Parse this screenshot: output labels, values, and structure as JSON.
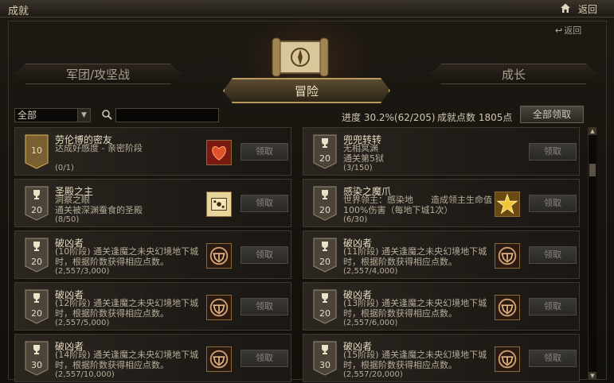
{
  "window": {
    "title": "成就",
    "back_label": "返回"
  },
  "sub_back_label": "返回",
  "tabs": {
    "left": "军团/攻坚战",
    "active": "冒险",
    "right": "成长"
  },
  "filter": {
    "selected": "全部",
    "search_placeholder": ""
  },
  "summary": {
    "progress": "进度 30.2%(62/205)",
    "points": "成就点数 1805点",
    "claim_all": "全部领取"
  },
  "colors": {
    "accent": "#b89a5e",
    "reward_red": "#c0301a",
    "reward_gold": "#e2b53a",
    "reward_dark": "#3a2a1a"
  },
  "achievements": [
    {
      "name": "劳伦博的密友",
      "desc": "达成好感度 - 亲密阶段",
      "progress": "(0/1)",
      "points": "10",
      "icon": "heart-reward-icon",
      "claim": "领取"
    },
    {
      "name": "兜兜转转",
      "desc": "无相冥渊\n通关第5狱",
      "progress": "(3/150)",
      "points": "20",
      "icon": "",
      "claim": "领取"
    },
    {
      "name": "圣殿之主",
      "desc": "洞察之眼\n通关被深渊蚕食的圣殿",
      "progress": "(8/50)",
      "points": "20",
      "icon": "map-reward-icon",
      "claim": "领取"
    },
    {
      "name": "感染之魔爪",
      "desc": "世界领主：感染地　　造成领主生命值100%伤害（每地下城1次）",
      "progress": "(6/30)",
      "points": "20",
      "icon": "star-reward-icon",
      "claim": "领取"
    },
    {
      "name": "破凶者",
      "desc": "(10阶段) 通关逢魔之未央幻境地下城时，根据阶数获得相应点数。",
      "progress": "(2,557/3,000)",
      "points": "20",
      "icon": "emblem-reward-icon",
      "claim": "领取"
    },
    {
      "name": "破凶者",
      "desc": "(11阶段) 通关逢魔之未央幻境地下城时，根据阶数获得相应点数。",
      "progress": "(2,557/4,000)",
      "points": "20",
      "icon": "emblem-reward-icon",
      "claim": "领取"
    },
    {
      "name": "破凶者",
      "desc": "(12阶段) 通关逢魔之未央幻境地下城时，根据阶数获得相应点数。",
      "progress": "(2,557/5,000)",
      "points": "20",
      "icon": "emblem-reward-icon",
      "claim": "领取"
    },
    {
      "name": "破凶者",
      "desc": "(13阶段) 通关逢魔之未央幻境地下城时，根据阶数获得相应点数。",
      "progress": "(2,557/6,000)",
      "points": "20",
      "icon": "emblem-reward-icon",
      "claim": "领取"
    },
    {
      "name": "破凶者",
      "desc": "(14阶段) 通关逢魔之未央幻境地下城时，根据阶数获得相应点数。",
      "progress": "(2,557/10,000)",
      "points": "30",
      "icon": "emblem-reward-icon",
      "claim": "领取"
    },
    {
      "name": "破凶者",
      "desc": "(15阶段) 通关逢魔之未央幻境地下城时，根据阶数获得相应点数。",
      "progress": "(2,557/20,000)",
      "points": "30",
      "icon": "emblem-reward-icon",
      "claim": "领取"
    }
  ]
}
